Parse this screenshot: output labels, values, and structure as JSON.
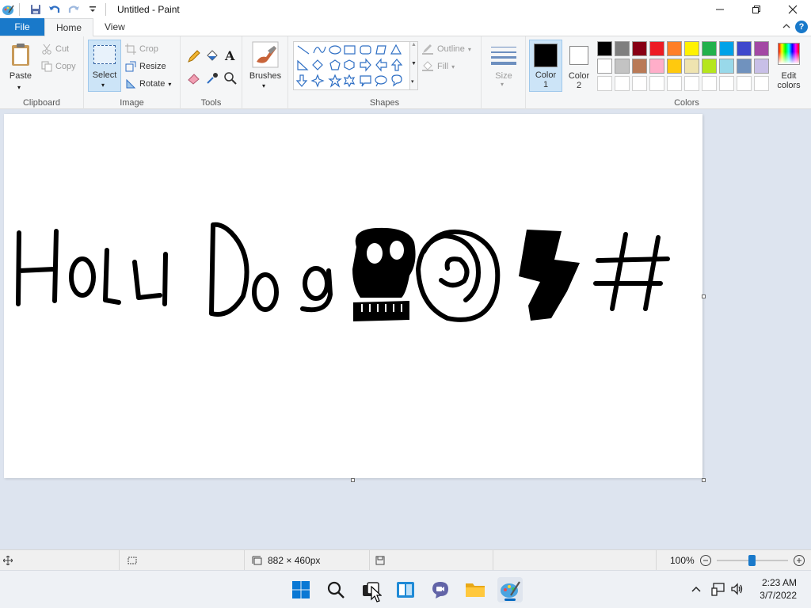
{
  "titlebar": {
    "title": "Untitled - Paint",
    "app_icon": "paint-palette-icon",
    "qat": [
      "save-icon",
      "undo-icon",
      "redo-icon",
      "customize-qat-icon"
    ],
    "controls": [
      "minimize-icon",
      "restore-icon",
      "close-icon"
    ]
  },
  "ribbon_tabs": [
    {
      "label": "File"
    },
    {
      "label": "Home",
      "active": true
    },
    {
      "label": "View"
    }
  ],
  "ribbon": {
    "clipboard": {
      "label": "Clipboard",
      "paste": "Paste",
      "cut": "Cut",
      "copy": "Copy"
    },
    "image": {
      "label": "Image",
      "select": "Select",
      "crop": "Crop",
      "resize": "Resize",
      "rotate": "Rotate"
    },
    "tools": {
      "label": "Tools"
    },
    "brushes": {
      "label": "Brushes"
    },
    "shapes": {
      "label": "Shapes",
      "outline": "Outline",
      "fill": "Fill"
    },
    "size": {
      "label": "Size"
    },
    "color1": {
      "label": "Color",
      "num": "1",
      "color": "#000000"
    },
    "color2": {
      "label": "Color",
      "num": "2",
      "color": "#ffffff"
    },
    "colors": {
      "label": "Colors",
      "edit_line1": "Edit",
      "edit_line2": "colors"
    }
  },
  "palette": {
    "row1": [
      "#000000",
      "#7f7f7f",
      "#880015",
      "#ed1c24",
      "#ff7f27",
      "#fff200",
      "#22b14c",
      "#00a2e8",
      "#3f48cc",
      "#a349a4"
    ],
    "row2": [
      "#ffffff",
      "#c3c3c3",
      "#b97a57",
      "#ffaec9",
      "#ffc90e",
      "#efe4b0",
      "#b5e61d",
      "#99d9ea",
      "#7092be",
      "#c8bfe7"
    ]
  },
  "canvas": {
    "drawing_text": "Holy Dog",
    "drawing_symbol": "#"
  },
  "statusbar": {
    "dimensions": "882 × 460px",
    "zoom": "100%",
    "zoom_level": 0.5
  },
  "taskbar": {
    "apps": [
      "windows-start-icon",
      "search-icon",
      "task-view-icon",
      "widgets-icon",
      "chat-icon",
      "file-explorer-icon",
      "paint-icon"
    ],
    "time": "2:23 AM",
    "date": "3/7/2022"
  }
}
